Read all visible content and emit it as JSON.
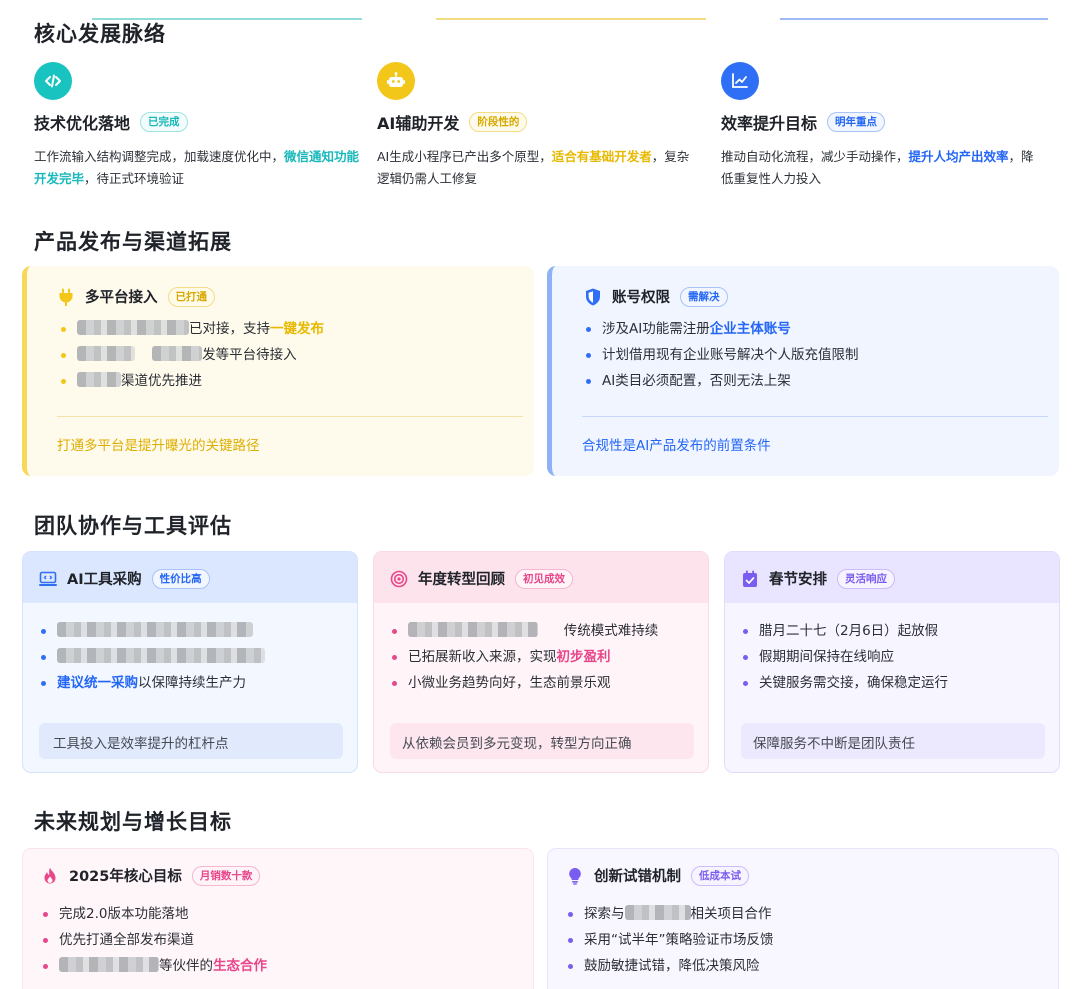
{
  "sections": {
    "timeline": "核心发展脉络",
    "release": "产品发布与渠道拓展",
    "team": "团队协作与工具评估",
    "future": "未来规划与增长目标"
  },
  "timeline": [
    {
      "icon": "code-icon",
      "color": "#19c3c0",
      "title": "技术优化落地",
      "badge": "已完成",
      "desc_a": "工作流输入结构调整完成，加载速度优化中，",
      "desc_hl": "微信通知功能开发完毕",
      "desc_b": "，待正式环境验证"
    },
    {
      "icon": "robot-icon",
      "color": "#f3c61a",
      "title": "AI辅助开发",
      "badge": "阶段性的",
      "desc_a": "AI生成小程序已产出多个原型，",
      "desc_hl": "适合有基础开发者",
      "desc_b": "，复杂逻辑仍需人工修复"
    },
    {
      "icon": "chart-icon",
      "color": "#2f6ff6",
      "title": "效率提升目标",
      "badge": "明年重点",
      "desc_a": "推动自动化流程，减少手动操作，",
      "desc_hl": "提升人均产出效率",
      "desc_b": "，降低重复性人力投入"
    }
  ],
  "release": {
    "platform": {
      "title": "多平台接入",
      "badge": "已打通",
      "b1_a": "已对接，支持",
      "b1_hl": "一键发布",
      "b2_a": "发等平台待接入",
      "b3_a": "渠道优先推进",
      "note": "打通多平台是提升曝光的关键路径"
    },
    "account": {
      "title": "账号权限",
      "badge": "需解决",
      "b1_a": "涉及AI功能需注册",
      "b1_hl": "企业主体账号",
      "b2": "计划借用现有企业账号解决个人版充值限制",
      "b3": "AI类目必须配置，否则无法上架",
      "note": "合规性是AI产品发布的前置条件"
    }
  },
  "team": {
    "tools": {
      "title": "AI工具采购",
      "badge": "性价比高",
      "b3_hl": "建议统一采购",
      "b3_b": "以保障持续生产力",
      "note": "工具投入是效率提升的杠杆点"
    },
    "review": {
      "title": "年度转型回顾",
      "badge": "初见成效",
      "b1_b": "传统模式难持续",
      "b2_a": "已拓展新收入来源，实现",
      "b2_hl": "初步盈利",
      "b3": "小微业务趋势向好，生态前景乐观",
      "note": "从依赖会员到多元变现，转型方向正确"
    },
    "holiday": {
      "title": "春节安排",
      "badge": "灵活响应",
      "b1": "腊月二十七（2月6日）起放假",
      "b2": "假期期间保持在线响应",
      "b3": "关键服务需交接，确保稳定运行",
      "note": "保障服务不中断是团队责任"
    }
  },
  "future": {
    "goal": {
      "title": "2025年核心目标",
      "badge": "月销数十款",
      "b1": "完成2.0版本功能落地",
      "b2": "优先打通全部发布渠道",
      "b3_a": "等伙伴的",
      "b3_hl": "生态合作"
    },
    "trial": {
      "title": "创新试错机制",
      "badge": "低成本试",
      "b1_a": "探索与",
      "b1_b": "相关项目合作",
      "b2": "采用“试半年”策略验证市场反馈",
      "b3": "鼓励敏捷试错，降低决策风险"
    }
  },
  "colors": {
    "teal": "#19c3c0",
    "yellow": "#f3c61a",
    "blue": "#2f6ff6",
    "pink": "#e8478b",
    "purple": "#7b5cf0"
  }
}
